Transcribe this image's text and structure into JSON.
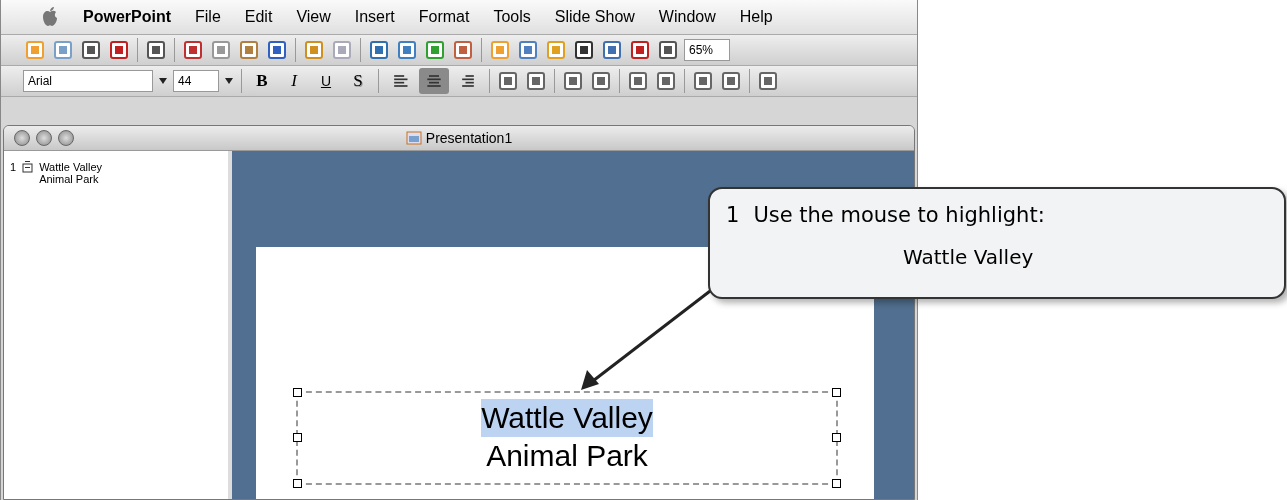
{
  "menu_bar": {
    "items": [
      {
        "label": "PowerPoint",
        "kind": "app"
      },
      {
        "label": "File",
        "kind": "menu"
      },
      {
        "label": "Edit",
        "kind": "menu"
      },
      {
        "label": "View",
        "kind": "menu"
      },
      {
        "label": "Insert",
        "kind": "menu"
      },
      {
        "label": "Format",
        "kind": "menu"
      },
      {
        "label": "Tools",
        "kind": "menu"
      },
      {
        "label": "Slide Show",
        "kind": "menu"
      },
      {
        "label": "Window",
        "kind": "menu"
      },
      {
        "label": "Help",
        "kind": "menu"
      }
    ]
  },
  "standard_toolbar": {
    "zoom": "65%"
  },
  "formatting_toolbar": {
    "font": "Arial",
    "size": "44",
    "styles": [
      {
        "label": "B",
        "kind": "bold"
      },
      {
        "label": "I",
        "kind": "italic"
      },
      {
        "label": "U",
        "kind": "underline"
      },
      {
        "label": "S",
        "kind": "shadow"
      }
    ],
    "alignments": [
      {
        "kind": "left",
        "selected": false
      },
      {
        "kind": "center",
        "selected": true
      },
      {
        "kind": "right",
        "selected": false
      }
    ]
  },
  "window": {
    "title": "Presentation1"
  },
  "outline": [
    {
      "number": "1",
      "lines": [
        "Wattle Valley",
        "Animal Park"
      ]
    }
  ],
  "slide": {
    "title_lines": [
      {
        "text": "Wattle Valley",
        "selected": true
      },
      {
        "text": "Animal Park",
        "selected": false
      }
    ]
  },
  "callout": {
    "step": "1",
    "text": "Use the mouse to highlight:",
    "target": "Wattle Valley"
  }
}
